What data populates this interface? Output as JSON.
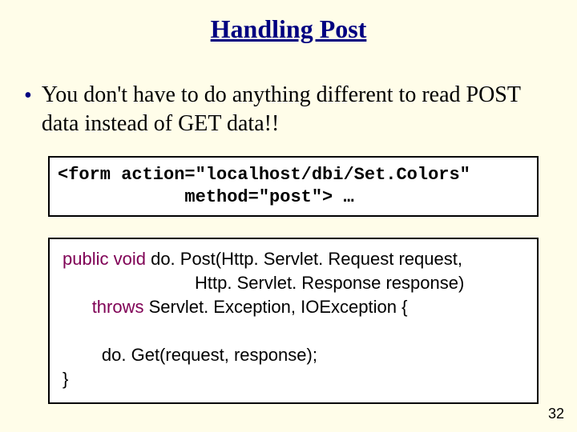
{
  "title": "Handling Post",
  "bullet": "You don't have to do anything different to read POST data instead of GET data!!",
  "code_html": {
    "line1": "<form action=\"localhost/dbi/Set.Colors\"",
    "line2": "            method=\"post\"> …"
  },
  "java": {
    "kw_public": "public",
    "kw_void": "void",
    "sig_head": " do. Post(Http. Servlet. Request request,",
    "sig_param2": "                           Http. Servlet. Response response)",
    "kw_throws": "throws",
    "throws_rest": " Servlet. Exception, IOException {",
    "body": "        do. Get(request, response);",
    "close": "}"
  },
  "page_number": "32"
}
